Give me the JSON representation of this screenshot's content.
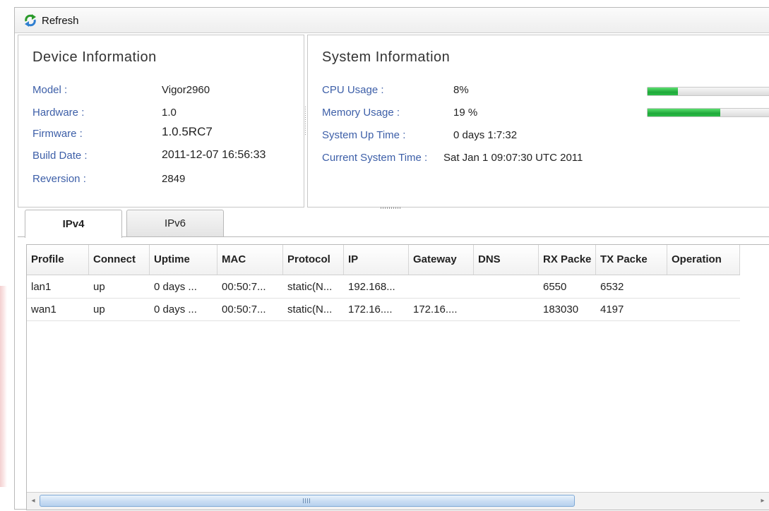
{
  "toolbar": {
    "refresh_label": "Refresh"
  },
  "device": {
    "title": "Device Information",
    "rows": [
      {
        "label": "Model :",
        "value": "Vigor2960"
      },
      {
        "label": "Hardware :",
        "value": "1.0"
      },
      {
        "label": "Firmware :",
        "value": "1.0.5RC7"
      },
      {
        "label": "Build Date :",
        "value": "2011-12-07 16:56:33"
      },
      {
        "label": "Reversion :",
        "value": "2849"
      }
    ]
  },
  "system": {
    "title": "System Information",
    "cpu_label": "CPU Usage :",
    "cpu_value": "8%",
    "cpu_fraction": 0.08,
    "memory_label": "Memory Usage :",
    "memory_value": "19 %",
    "memory_fraction": 0.19,
    "uptime_label": "System Up Time :",
    "uptime_value": "0 days 1:7:32",
    "time_label": "Current System Time :",
    "time_value": "Sat Jan 1 09:07:30 UTC 2011"
  },
  "tabs": [
    {
      "label": "IPv4",
      "active": true
    },
    {
      "label": "IPv6",
      "active": false
    }
  ],
  "table": {
    "columns": [
      "Profile",
      "Connect",
      "Uptime",
      "MAC",
      "Protocol",
      "IP",
      "Gateway",
      "DNS",
      "RX Packe",
      "TX Packe",
      "Operation"
    ],
    "rows": [
      [
        "lan1",
        "up",
        "0 days ...",
        "00:50:7...",
        "static(N...",
        "192.168...",
        "",
        "",
        "6550",
        "6532",
        ""
      ],
      [
        "wan1",
        "up",
        "0 days ...",
        "00:50:7...",
        "static(N...",
        "172.16....",
        "172.16....",
        "",
        "183030",
        "4197",
        ""
      ]
    ]
  },
  "scrollbar": {
    "left_arrow": "◂",
    "right_arrow": "▸"
  },
  "colors": {
    "accent_label": "#3d5fa8",
    "progress": "#22b03e"
  }
}
